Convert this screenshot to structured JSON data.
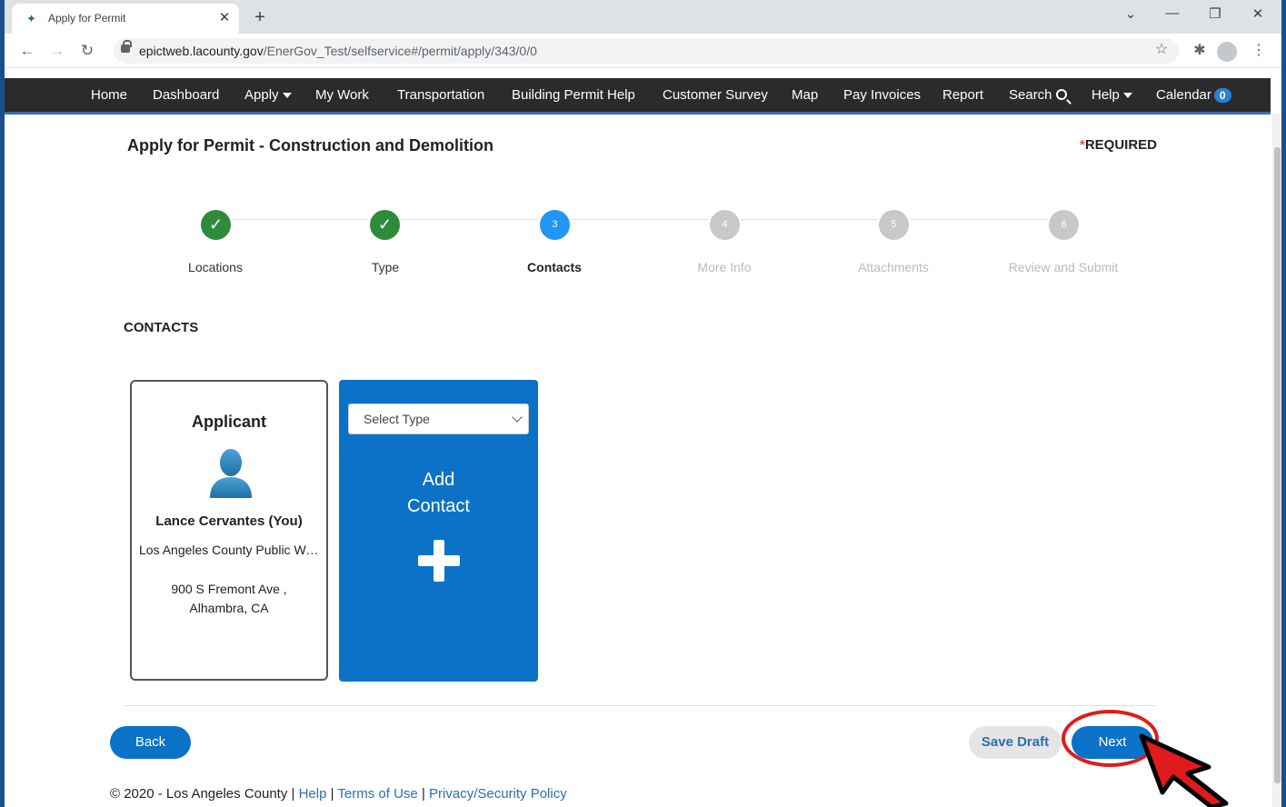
{
  "browser": {
    "tab_title": "Apply for Permit",
    "url_host": "epictweb.lacounty.gov",
    "url_path": "/EnerGov_Test/selfservice#/permit/apply/343/0/0"
  },
  "nav": {
    "items": [
      {
        "label": "Home"
      },
      {
        "label": "Dashboard"
      },
      {
        "label": "Apply"
      },
      {
        "label": "My Work"
      },
      {
        "label": "Transportation"
      },
      {
        "label": "Building Permit Help"
      },
      {
        "label": "Customer Survey"
      },
      {
        "label": "Map"
      },
      {
        "label": "Pay Invoices"
      },
      {
        "label": "Report"
      },
      {
        "label": "Search"
      },
      {
        "label": "Help"
      },
      {
        "label": "Calendar"
      }
    ],
    "calendar_count": "0"
  },
  "page": {
    "title": "Apply for Permit - Construction and Demolition",
    "required_star": "*",
    "required_label": "REQUIRED"
  },
  "steps": [
    {
      "label": "Locations",
      "marker": "✓",
      "state": "done"
    },
    {
      "label": "Type",
      "marker": "✓",
      "state": "done"
    },
    {
      "label": "Contacts",
      "marker": "3",
      "state": "active"
    },
    {
      "label": "More Info",
      "marker": "4",
      "state": "todo"
    },
    {
      "label": "Attachments",
      "marker": "5",
      "state": "todo"
    },
    {
      "label": "Review and Submit",
      "marker": "6",
      "state": "todo"
    }
  ],
  "contacts": {
    "heading": "CONTACTS",
    "applicant": {
      "role": "Applicant",
      "name": "Lance Cervantes (You)",
      "organization": "Los Angeles County Public Works",
      "address_line1": "900 S Fremont Ave ,",
      "address_line2": "Alhambra, CA"
    },
    "add_card": {
      "select_placeholder": "Select Type",
      "label_line1": "Add",
      "label_line2": "Contact"
    }
  },
  "actions": {
    "back": "Back",
    "save_draft": "Save Draft",
    "next": "Next"
  },
  "footer": {
    "copyright": "© 2020 - Los Angeles County",
    "help": "Help",
    "terms": "Terms of Use",
    "privacy": "Privacy/Security Policy",
    "separator": " | "
  },
  "colors": {
    "primary_blue": "#0b72c7",
    "step_done": "#2e8b3a",
    "step_active": "#2196f3",
    "annotation_red": "#e11b1b"
  }
}
